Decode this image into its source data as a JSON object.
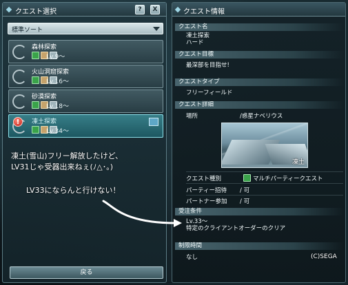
{
  "left_panel": {
    "title": "クエスト選択",
    "help_label": "?",
    "close_label": "X",
    "sort": {
      "value": "標準ソート"
    },
    "quests": [
      {
        "name": "森林探索",
        "level": "Lv.9〜"
      },
      {
        "name": "火山洞窟探索",
        "level": "Lv.16〜"
      },
      {
        "name": "砂漠探索",
        "level": "Lv.18〜"
      },
      {
        "name": "凍土探索",
        "level": "Lv.34〜",
        "alert": "!"
      }
    ],
    "back_label": "戻る"
  },
  "overlay": {
    "comment_line1": "凍土(雪山)フリー解放したけど、",
    "comment_line2": "LV31じゃ受器出来ねぇ(ﾉ△･｡)",
    "comment_line3": "LV33にならんと行けない！",
    "copyright": "(C)SEGA"
  },
  "right_panel": {
    "title": "クエスト情報",
    "quest_name_head": "クエスト名",
    "quest_name_line1": "凍土探索",
    "quest_name_line2": "ハード",
    "goal_head": "クエスト目標",
    "goal_text": "最深部を目指せ!",
    "type_head": "クエストタイプ",
    "type_text": "フリーフィールド",
    "detail_head": "クエスト詳細",
    "location_label": "場所",
    "location_value": "/惑星ナベリウス",
    "preview_caption": "凍土",
    "category_label": "クエスト種別",
    "category_value": "マルチパーティークエスト",
    "party_invite_label": "パーティー招待",
    "party_invite_value": "/ 可",
    "partner_label": "パートナー参加",
    "partner_value": "/ 可",
    "conditions_head": "受注条件",
    "conditions_line1": "Lv.33〜",
    "conditions_line2": "特定のクライアントオーダーのクリア",
    "time_head": "制限時間",
    "time_text": "なし"
  }
}
